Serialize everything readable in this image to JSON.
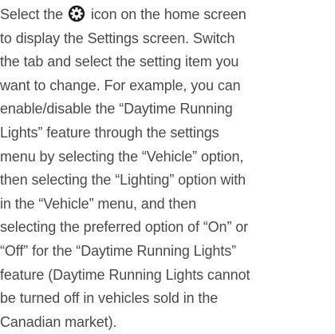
{
  "paragraph": {
    "line1_before_icon": "Select the ",
    "line1_after_icon": " icon on the home screen",
    "lines": [
      "to display the Settings screen. Switch",
      "the tab and select the setting item you",
      "want to change. For example, you can",
      "enable/disable the “Daytime Running",
      "Lights” feature through the settings",
      "menu by selecting the “Vehicle” option,",
      "then selecting the “Lighting” option with",
      "in the “Vehicle” menu, and then",
      "selecting the preferred option of “On” or",
      "“Off” for the “Daytime Running Lights”",
      "feature (Daytime Running Lights cannot",
      "be turned off in vehicles sold in the",
      "Canadian market)."
    ]
  },
  "icons": {
    "settings": "gear-icon"
  },
  "colors": {
    "text": "#4a4a4a",
    "icon": "#1a1a1a"
  }
}
